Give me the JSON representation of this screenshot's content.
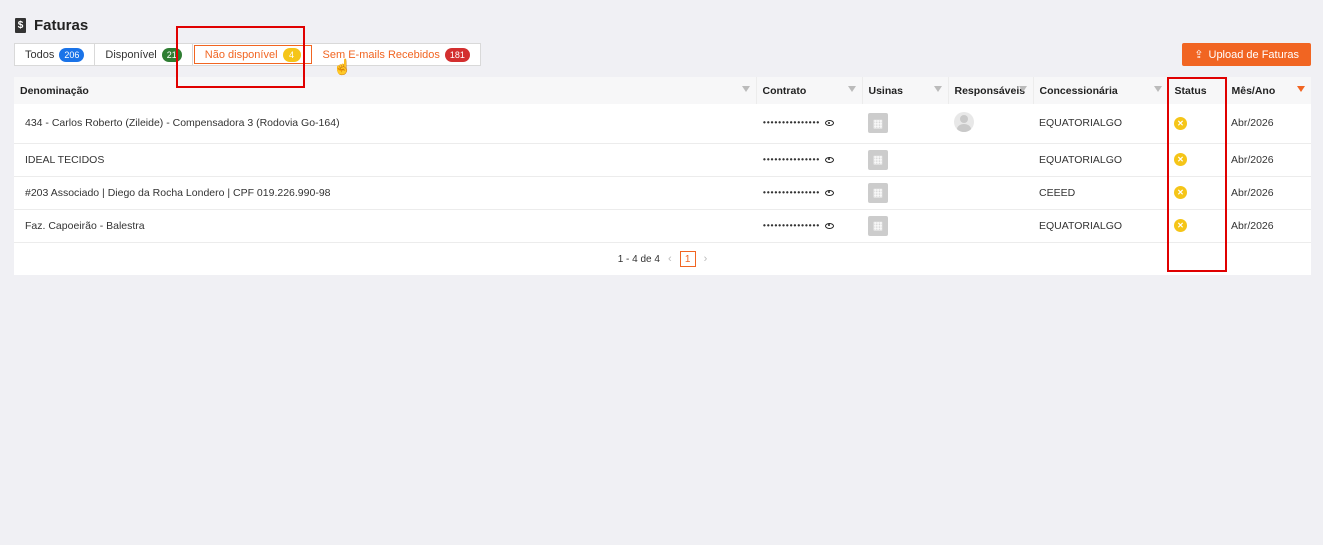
{
  "header": {
    "title": "Faturas",
    "icon": "invoice-dollar-icon"
  },
  "tabs": [
    {
      "label": "Todos",
      "count": "206",
      "color": "#1a73e8"
    },
    {
      "label": "Disponível",
      "count": "21",
      "color": "#2e7d32"
    },
    {
      "label": "Não disponível",
      "count": "4",
      "color": "#f5c518"
    },
    {
      "label": "Sem E-mails Recebidos",
      "count": "181",
      "color": "#d32f2f"
    }
  ],
  "upload_button": {
    "label": "Upload de Faturas",
    "icon": "upload-icon"
  },
  "columns": [
    "Denominação",
    "Contrato",
    "Usinas",
    "Responsáveis",
    "Concessionária",
    "Status",
    "Mês/Ano"
  ],
  "rows": [
    {
      "name": "434 - Carlos Roberto (Zileide) - Compensadora 3 (Rodovia Go-164)",
      "contract": "•••••••••••••••",
      "has_avatar": true,
      "utility": "EQUATORIALGO",
      "month": "Abr/2026"
    },
    {
      "name": "IDEAL TECIDOS",
      "contract": "•••••••••••••••",
      "has_avatar": false,
      "utility": "EQUATORIALGO",
      "month": "Abr/2026"
    },
    {
      "name": "#203 Associado | Diego da Rocha Londero | CPF 019.226.990-98",
      "contract": "•••••••••••••••",
      "has_avatar": false,
      "utility": "CEEED",
      "month": "Abr/2026"
    },
    {
      "name": "Faz. Capoeirão - Balestra",
      "contract": "•••••••••••••••",
      "has_avatar": false,
      "utility": "EQUATORIALGO",
      "month": "Abr/2026"
    }
  ],
  "pagination": {
    "range": "1 - 4 de 4",
    "current": "1"
  },
  "accent_color": "#f16522"
}
